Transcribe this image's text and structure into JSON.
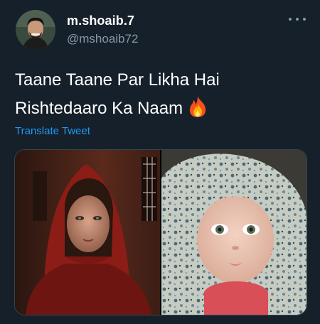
{
  "author": {
    "display_name": "m.shoaib.7",
    "handle": "@mshoaib72"
  },
  "tweet": {
    "text_line1": "Taane Taane Par Likha Hai",
    "text_line2": "Rishtedaaro Ka Naam",
    "emoji": "fire-emoji",
    "translate_label": "Translate Tweet"
  },
  "icons": {
    "more": "more-horizontal-icon"
  },
  "colors": {
    "background": "#15202b",
    "link": "#1d9bf0",
    "muted": "#8899a6"
  }
}
